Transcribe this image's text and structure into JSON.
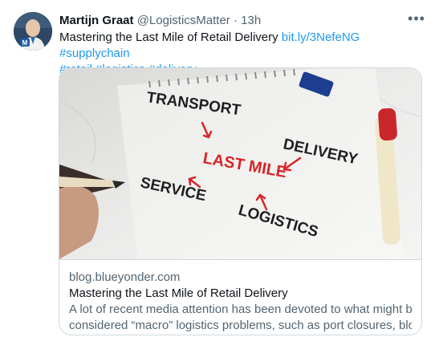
{
  "tweet": {
    "author_name": "Martijn Graat",
    "author_handle": "@LogisticsMatter",
    "separator": "·",
    "time": "13h",
    "more_label": "•••",
    "text_main": "Mastering the Last Mile of Retail Delivery",
    "links": [
      "bit.ly/3NefeNG",
      "#supplychain",
      "#retail",
      "#logistics",
      "#delivery"
    ]
  },
  "card": {
    "domain": "blog.blueyonder.com",
    "title": "Mastering the Last Mile of Retail Delivery",
    "description_line1": "A lot of recent media attention has been devoted to what might be",
    "description_line2": "considered “macro” logistics problems, such as port closures, blocke...",
    "image_words": {
      "transport": "TRANSPORT",
      "delivery": "DELIVERY",
      "last_mile": "LAST MILE",
      "service": "SERVICE",
      "logistics": "LOGISTICS"
    }
  },
  "colors": {
    "link": "#1d9bf0",
    "secondary_text": "#536471",
    "border": "#cfd9de",
    "accent_red": "#d7262b"
  }
}
